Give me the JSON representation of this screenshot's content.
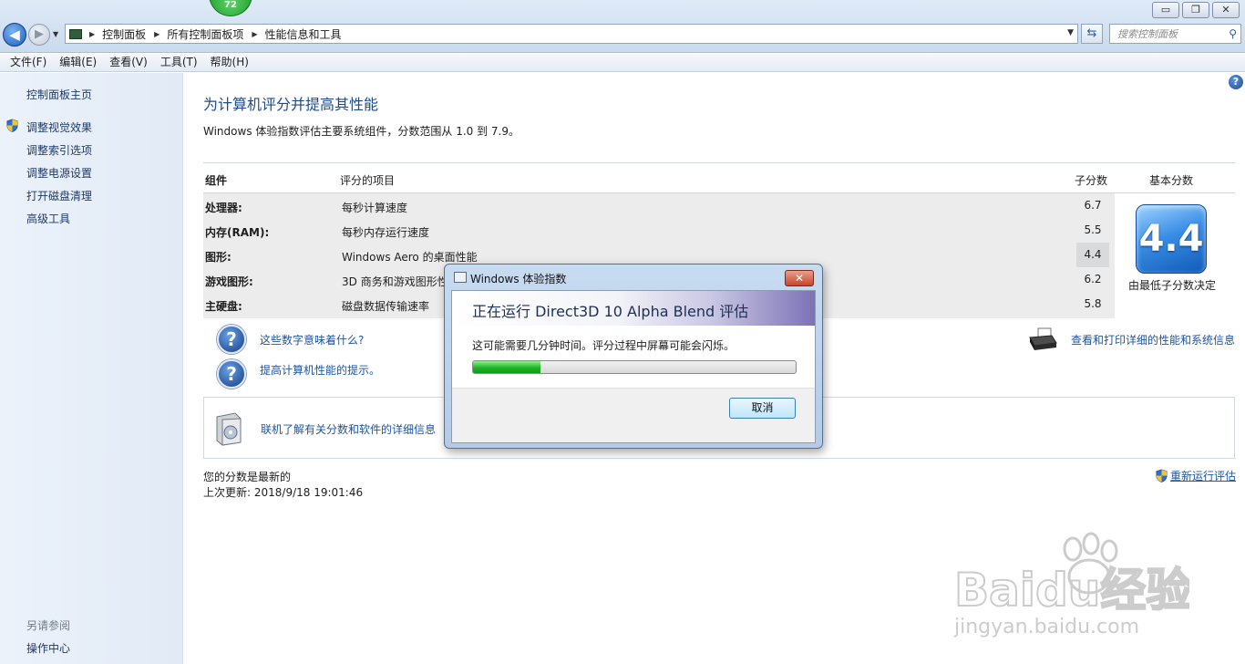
{
  "window": {
    "badge": "72",
    "controls": {
      "minimize": "▭",
      "maximize": "❐",
      "close": "✕"
    }
  },
  "address": {
    "breadcrumbs": [
      "控制面板",
      "所有控制面板项",
      "性能信息和工具"
    ],
    "search_placeholder": "搜索控制面板"
  },
  "menu": [
    "文件(F)",
    "编辑(E)",
    "查看(V)",
    "工具(T)",
    "帮助(H)"
  ],
  "sidebar": {
    "home": "控制面板主页",
    "links": [
      "调整视觉效果",
      "调整索引选项",
      "调整电源设置",
      "打开磁盘清理",
      "高级工具"
    ],
    "see_also_title": "另请参阅",
    "see_also_links": [
      "操作中心"
    ]
  },
  "main": {
    "title": "为计算机评分并提高其性能",
    "description": "Windows 体验指数评估主要系统组件，分数范围从 1.0 到 7.9。",
    "columns": {
      "component": "组件",
      "rated": "评分的项目",
      "subscore": "子分数",
      "base": "基本分数"
    },
    "rows": [
      {
        "component": "处理器:",
        "item": "每秒计算速度",
        "score": "6.7"
      },
      {
        "component": "内存(RAM):",
        "item": "每秒内存运行速度",
        "score": "5.5"
      },
      {
        "component": "图形:",
        "item": "Windows Aero 的桌面性能",
        "score": "4.4"
      },
      {
        "component": "游戏图形:",
        "item": "3D 商务和游戏图形性",
        "score": "6.2"
      },
      {
        "component": "主硬盘:",
        "item": "磁盘数据传输速率",
        "score": "5.8"
      }
    ],
    "base_score": "4.4",
    "base_label": "由最低子分数决定",
    "link_meaning": "这些数字意味着什么?",
    "link_tips": "提高计算机性能的提示。",
    "link_print": "查看和打印详细的性能和系统信息",
    "link_online": "联机了解有关分数和软件的详细信息",
    "status_current": "您的分数是最新的",
    "status_last_update": "上次更新: 2018/9/18 19:01:46",
    "rerun": "重新运行评估"
  },
  "dialog": {
    "title": "Windows 体验指数",
    "heading": "正在运行 Direct3D 10 Alpha Blend 评估",
    "message": "这可能需要几分钟时间。评分过程中屏幕可能会闪烁。",
    "progress_percent": 21,
    "cancel": "取消",
    "close": "✕"
  },
  "watermark": {
    "brand": "Baidu经验",
    "url": "jingyan.baidu.com"
  },
  "colors": {
    "accent_link": "#1c55a6",
    "progress_green": "#1fb529",
    "title_blue": "#1e4a8a"
  }
}
